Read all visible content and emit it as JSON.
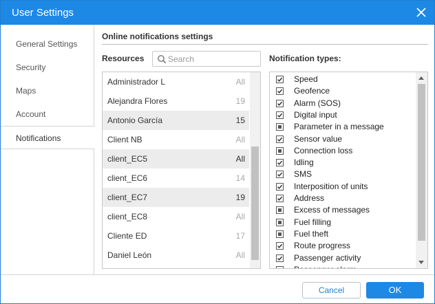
{
  "window": {
    "title": "User Settings",
    "close_icon": "close-icon"
  },
  "sidebar": {
    "items": [
      {
        "label": "General Settings",
        "active": false
      },
      {
        "label": "Security",
        "active": false
      },
      {
        "label": "Maps",
        "active": false
      },
      {
        "label": "Account",
        "active": false
      },
      {
        "label": "Notifications",
        "active": true
      }
    ]
  },
  "main": {
    "section_title": "Online notifications settings",
    "resources_label": "Resources",
    "search": {
      "placeholder": "Search",
      "value": "",
      "icon": "search-icon"
    },
    "resources": [
      {
        "name": "Administrador L",
        "value": "All",
        "strong": false,
        "alt": false
      },
      {
        "name": "Alejandra Flores",
        "value": "19",
        "strong": false,
        "alt": false
      },
      {
        "name": "Antonio García",
        "value": "15",
        "strong": true,
        "alt": true
      },
      {
        "name": "Client NB",
        "value": "All",
        "strong": false,
        "alt": false
      },
      {
        "name": "client_EC5",
        "value": "All",
        "strong": true,
        "alt": true
      },
      {
        "name": "client_EC6",
        "value": "14",
        "strong": false,
        "alt": false
      },
      {
        "name": "client_EC7",
        "value": "19",
        "strong": true,
        "alt": true
      },
      {
        "name": "client_EC8",
        "value": "All",
        "strong": false,
        "alt": false
      },
      {
        "name": "Cliente ED",
        "value": "17",
        "strong": false,
        "alt": false
      },
      {
        "name": "Daniel León",
        "value": "All",
        "strong": false,
        "alt": false
      }
    ],
    "notification_types_label": "Notification types:",
    "notification_types": [
      {
        "label": "Speed",
        "state": "checked"
      },
      {
        "label": "Geofence",
        "state": "checked"
      },
      {
        "label": "Alarm (SOS)",
        "state": "checked"
      },
      {
        "label": "Digital input",
        "state": "checked"
      },
      {
        "label": "Parameter in a message",
        "state": "partial"
      },
      {
        "label": "Sensor value",
        "state": "checked"
      },
      {
        "label": "Connection loss",
        "state": "partial"
      },
      {
        "label": "Idling",
        "state": "checked"
      },
      {
        "label": "SMS",
        "state": "checked"
      },
      {
        "label": "Interposition of units",
        "state": "checked"
      },
      {
        "label": "Address",
        "state": "checked"
      },
      {
        "label": "Excess of messages",
        "state": "partial"
      },
      {
        "label": "Fuel filling",
        "state": "partial"
      },
      {
        "label": "Fuel theft",
        "state": "partial"
      },
      {
        "label": "Route progress",
        "state": "checked"
      },
      {
        "label": "Passenger activity",
        "state": "checked"
      },
      {
        "label": "Passenger alarm",
        "state": "partial"
      }
    ]
  },
  "footer": {
    "cancel_label": "Cancel",
    "ok_label": "OK"
  },
  "colors": {
    "accent": "#1e88e5",
    "muted": "#a8a8a8",
    "row_alt": "#ececec"
  }
}
